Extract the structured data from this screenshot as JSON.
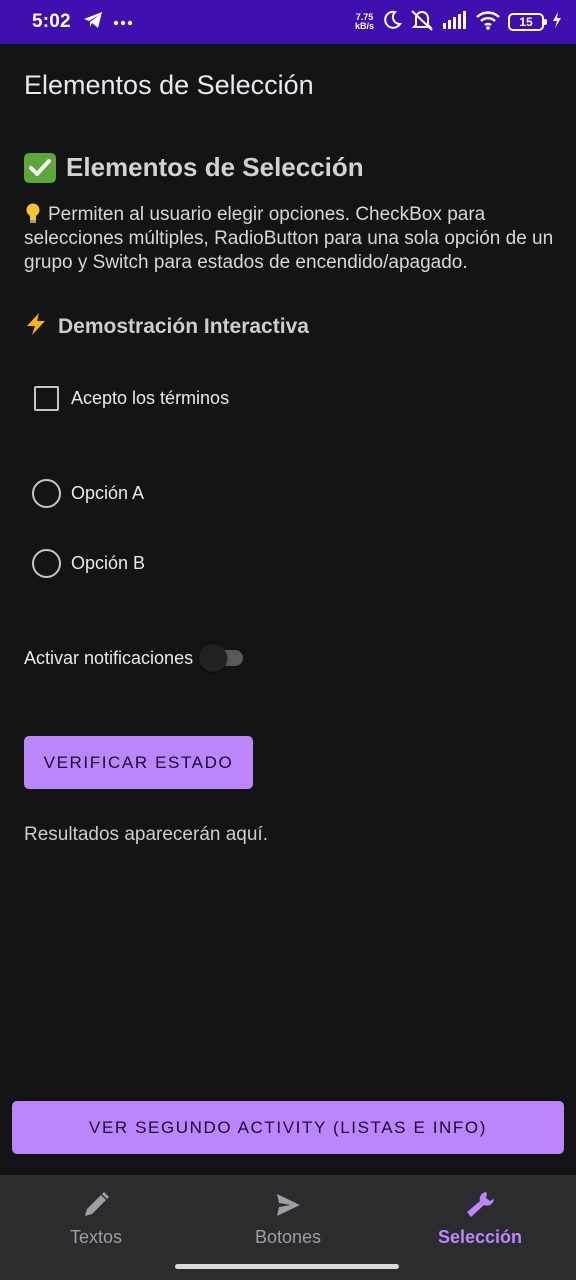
{
  "status_bar": {
    "time": "5:02",
    "net_speed_value": "7.75",
    "net_speed_unit": "kB/s",
    "battery_level": "15"
  },
  "app_bar": {
    "title": "Elementos de Selección"
  },
  "content": {
    "section_title": "Elementos de Selección",
    "description": "Permiten al usuario elegir opciones. CheckBox para selecciones múltiples, RadioButton para una sola opción de un grupo y Switch para estados de encendido/apagado.",
    "demo_title": "Demostración Interactiva",
    "checkbox_label": "Acepto los términos",
    "checkbox_checked": false,
    "radio_options": [
      "Opción A",
      "Opción B"
    ],
    "switch_label": "Activar notificaciones",
    "switch_on": false,
    "verify_button": "VERIFICAR ESTADO",
    "results_text": "Resultados aparecerán aquí.",
    "second_activity_button": "VER SEGUNDO ACTIVITY (LISTAS E INFO)"
  },
  "bottom_nav": {
    "items": [
      {
        "label": "Textos",
        "icon": "pencil-icon",
        "active": false
      },
      {
        "label": "Botones",
        "icon": "send-icon",
        "active": false
      },
      {
        "label": "Selección",
        "icon": "wrench-icon",
        "active": true
      }
    ]
  },
  "colors": {
    "status_bar": "#3f0fb0",
    "background": "#141414",
    "accent": "#bb86fc",
    "nav_background": "#2c2b2d"
  }
}
